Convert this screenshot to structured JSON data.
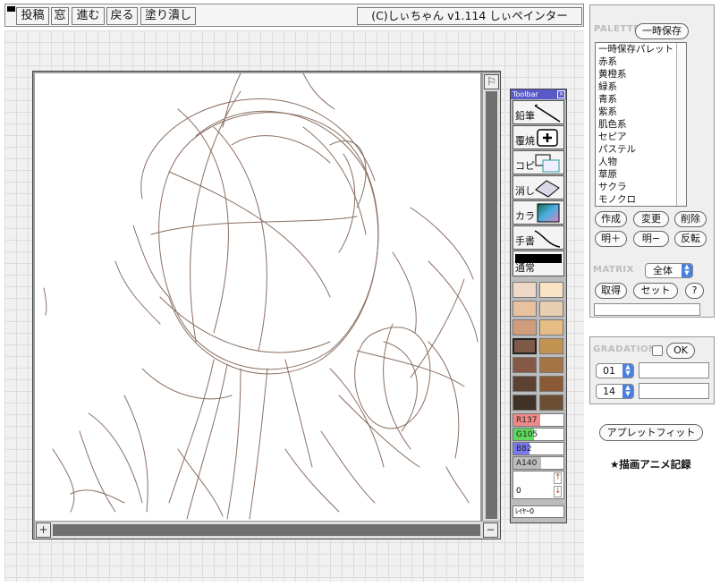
{
  "menu": {
    "buttons": [
      "投稿",
      "窓",
      "進む",
      "戻る",
      "塗り潰し"
    ],
    "credit": "(C)しぃちゃん v1.114 しぃペインター"
  },
  "canvas": {
    "flag_glyph": "⚐",
    "plus_glyph": "+",
    "minus_glyph": "−",
    "stroke_color": "#8a6f62"
  },
  "toolbar": {
    "title": "Toolbar",
    "close_glyph": "×",
    "tools": [
      "鉛筆",
      "覆焼",
      "コピ",
      "消し",
      "カラ",
      "手書"
    ],
    "mode_label": "通常",
    "swatches": [
      "#f0d8c8",
      "#fbe4c6",
      "#e8c29e",
      "#e8cfb1",
      "#cf9d7c",
      "#e6bd85",
      "#7e5a48",
      "#c29250",
      "#865846",
      "#a57445",
      "#5d4132",
      "#8a5a36",
      "#3f3126",
      "#6b4e33"
    ],
    "selected_swatch": 6,
    "sliders": [
      {
        "label": "R137",
        "value": 137,
        "color": "#f08a8a"
      },
      {
        "label": "G105",
        "value": 105,
        "color": "#5fd85f"
      },
      {
        "label": "B82",
        "value": 82,
        "color": "#7a7af0"
      },
      {
        "label": "A140",
        "value": 140,
        "color": "#bdbdbd"
      }
    ],
    "layer_value": "0",
    "layer_label": "ﾚｲﾔｰ0",
    "up_arrow": "↑",
    "down_arrow": "↓",
    "accent": "#5959c8"
  },
  "palette": {
    "title": "PALETTE",
    "save_button": "一時保存",
    "items": [
      "一時保存パレット",
      "赤系",
      "黄橙系",
      "緑系",
      "青系",
      "紫系",
      "肌色系",
      "セピア",
      "パステル",
      "人物",
      "草原",
      "サクラ",
      "モノクロ"
    ],
    "buttons_row1": [
      "作成",
      "変更",
      "削除"
    ],
    "buttons_row2": [
      "明＋",
      "明−",
      "反転"
    ]
  },
  "matrix": {
    "title": "MATRIX",
    "select_value": "全体",
    "buttons": [
      "取得",
      "セット",
      "?"
    ]
  },
  "gradation": {
    "title": "GRADATION",
    "ok_button": "OK",
    "select1": "01",
    "select2": "14"
  },
  "footer": {
    "applet_fit": "アプレットフィット",
    "anim_record": "★描画アニメ記録"
  }
}
